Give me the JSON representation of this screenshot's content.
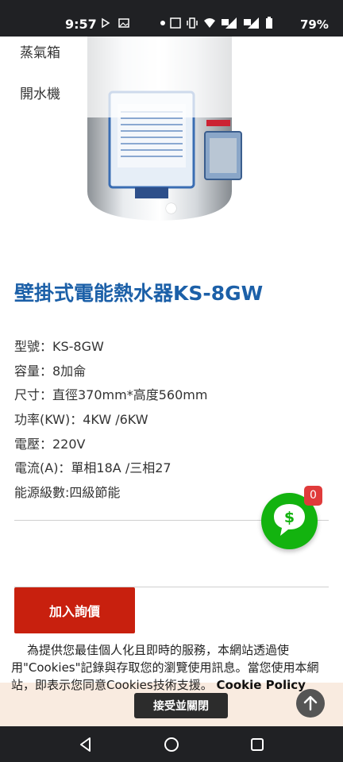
{
  "status_bar": {
    "time": "9:57",
    "battery": "79%",
    "icons": [
      "play-icon",
      "image-icon",
      "dot-icon",
      "nfc-icon",
      "vibrate-icon",
      "wifi-icon",
      "lte-signal-icon",
      "lte2-signal-icon",
      "battery-icon"
    ]
  },
  "side_menu": {
    "items": [
      "蒸氣箱",
      "開水機"
    ]
  },
  "product": {
    "title": "壁掛式電能熱水器KS-8GW",
    "specs": [
      "型號：KS-8GW",
      "容量：8加侖",
      "尺寸：直徑370mm*高度560mm",
      "功率(KW)：4KW /6KW",
      "電壓：220V",
      "電流(A)：單相18A /三相27",
      "能源級數:四級節能"
    ]
  },
  "actions": {
    "inquiry_label": "加入詢價"
  },
  "chat": {
    "badge_count": "0",
    "icon": "chat-dollar-icon"
  },
  "cookie": {
    "text": "為提供您最佳個人化且即時的服務，本網站透過使用\"Cookies\"記錄與存取您的瀏覽使用訊息。當您使用本網站，即表示您同意Cookies技術支援。",
    "policy_link": "Cookie Policy",
    "accept_label": "接受並關閉"
  },
  "colors": {
    "title": "#1c60a8",
    "inquiry_button": "#c8200e",
    "chat_fab": "#13b30f",
    "badge": "#e03b3b"
  }
}
